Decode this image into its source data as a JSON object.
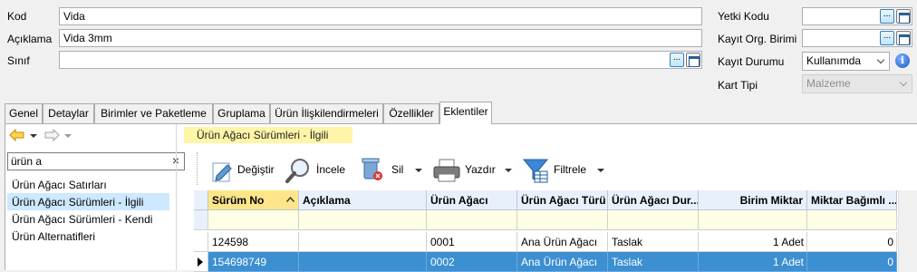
{
  "form": {
    "kod_label": "Kod",
    "kod_value": "Vida",
    "aciklama_label": "Açıklama",
    "aciklama_value": "Vida 3mm",
    "sinif_label": "Sınıf",
    "sinif_value": "",
    "yetki_kodu_label": "Yetki Kodu",
    "kayit_org_label": "Kayıt Org. Birimi",
    "kayit_durumu_label": "Kayıt Durumu",
    "kayit_durumu_value": "Kullanımda",
    "kart_tipi_label": "Kart Tipi",
    "kart_tipi_value": "Malzeme",
    "ellipsis": "..."
  },
  "tabs": [
    {
      "label": "Genel"
    },
    {
      "label": "Detaylar"
    },
    {
      "label": "Birimler ve Paketleme"
    },
    {
      "label": "Gruplama"
    },
    {
      "label": "Ürün İlişkilendirmeleri"
    },
    {
      "label": "Özellikler"
    },
    {
      "label": "Eklentiler",
      "active": true
    }
  ],
  "left_panel": {
    "search_value": "ürün a",
    "clear": "×",
    "items": [
      {
        "label": "Ürün Ağacı Satırları"
      },
      {
        "label": "Ürün Ağacı Sürümleri - İlgili",
        "selected": true
      },
      {
        "label": "Ürün Ağacı Sürümleri - Kendi"
      },
      {
        "label": "Ürün Alternatifleri"
      }
    ]
  },
  "section_title": "Ürün Ağacı Sürümleri - İlgili",
  "toolbar": {
    "degistir": "Değiştir",
    "incele": "İncele",
    "sil": "Sil",
    "yazdir": "Yazdır",
    "filtrele": "Filtrele"
  },
  "grid": {
    "columns": [
      "Sürüm No",
      "Açıklama",
      "Ürün Ağacı",
      "Ürün Ağacı Türü",
      "Ürün Ağacı Dur...",
      "Birim Miktar",
      "Miktar Bağımlı ..."
    ],
    "rows": [
      [
        "124598",
        "",
        "0001",
        "Ana Ürün Ağacı",
        "Taslak",
        "1 Adet",
        "0"
      ],
      [
        "154698749",
        "",
        "0002",
        "Ana Ürün Ağacı",
        "Taslak",
        "1 Adet",
        "0"
      ]
    ]
  },
  "colors": {
    "accent": "#3c8fd1",
    "header_bg": "#e8f1fb",
    "sorted_header": "#fde58a",
    "section_highlight": "#fff5a8"
  }
}
